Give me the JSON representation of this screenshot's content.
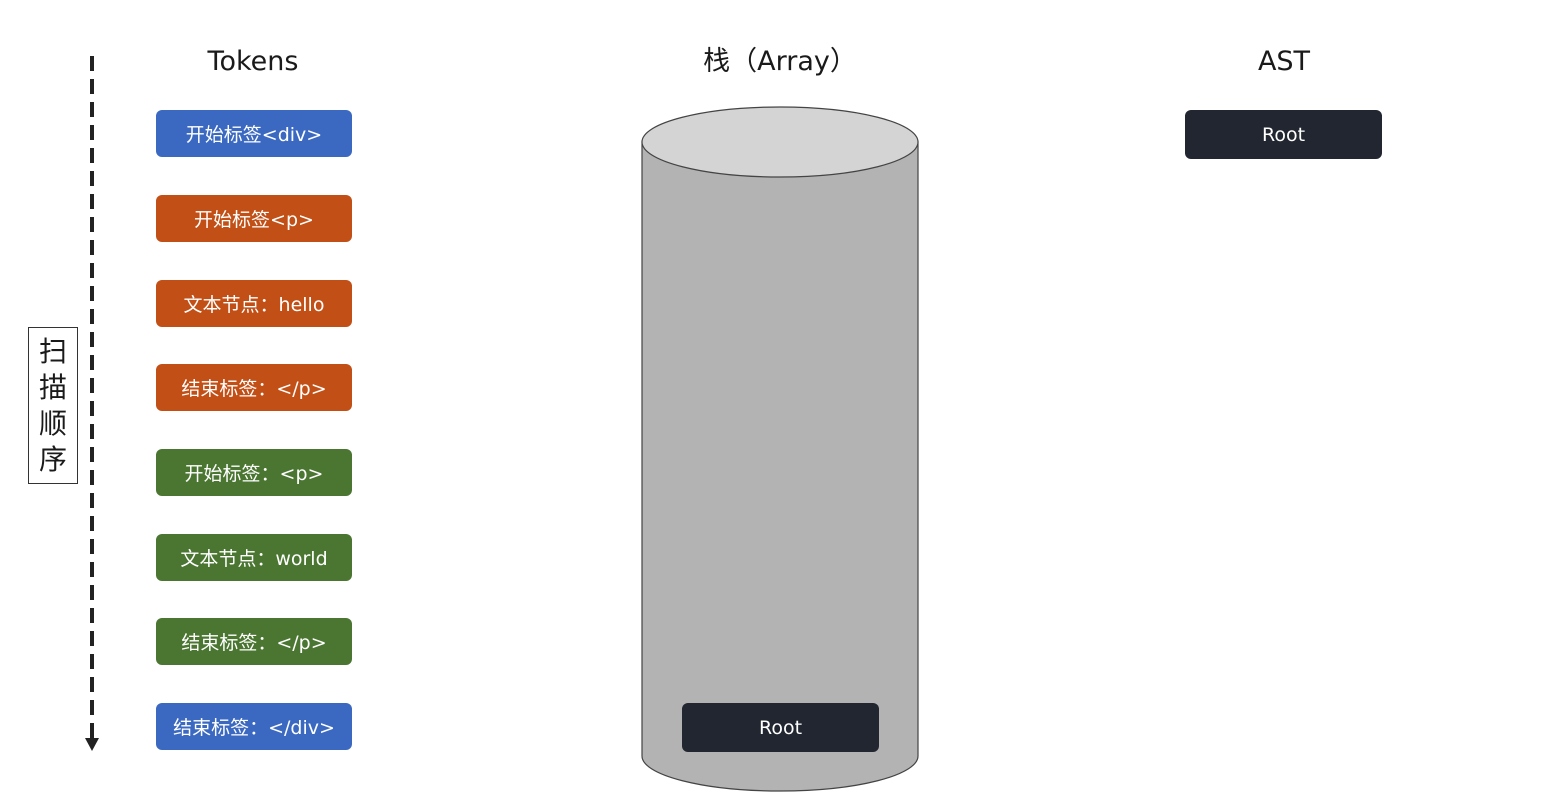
{
  "columns": {
    "tokens_title": "Tokens",
    "stack_title": "栈（Array）",
    "ast_title": "AST"
  },
  "scan_order_label": "扫描顺序",
  "tokens": [
    {
      "label": "开始标签<div>",
      "color": "#3b69c2"
    },
    {
      "label": "开始标签<p>",
      "color": "#c24f16"
    },
    {
      "label": "文本节点：hello",
      "color": "#c24f16"
    },
    {
      "label": "结束标签：</p>",
      "color": "#c24f16"
    },
    {
      "label": "开始标签：<p>",
      "color": "#4a7631"
    },
    {
      "label": "文本节点：world",
      "color": "#4a7631"
    },
    {
      "label": "结束标签：</p>",
      "color": "#4a7631"
    },
    {
      "label": "结束标签：</div>",
      "color": "#3b69c2"
    }
  ],
  "stack": {
    "items": [
      "Root"
    ]
  },
  "ast": {
    "root_label": "Root"
  },
  "colors": {
    "cylinder_body": "#b3b3b3",
    "cylinder_top": "#d4d4d4",
    "node_bg": "#212630"
  }
}
